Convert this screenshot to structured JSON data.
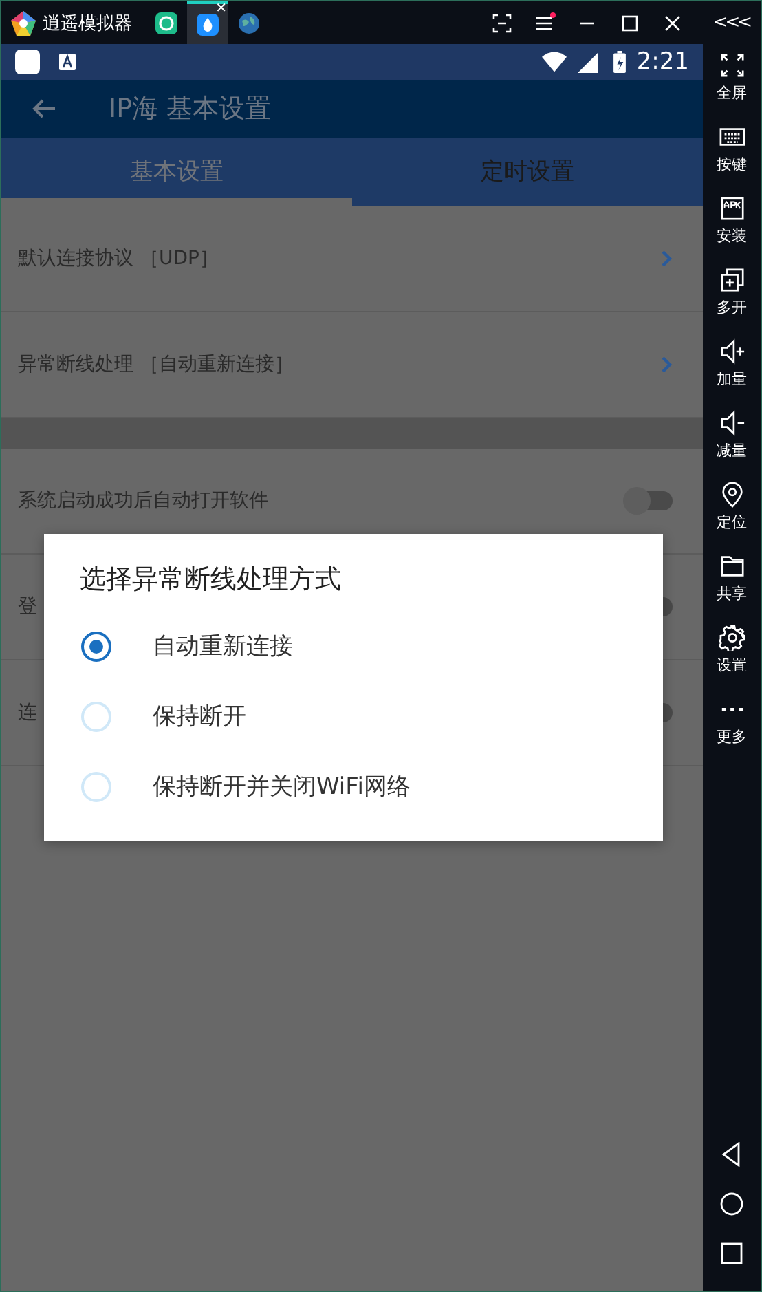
{
  "emulator": {
    "title": "逍遥模拟器",
    "app_tabs": [
      {
        "kind": "green",
        "selected": false
      },
      {
        "kind": "drop",
        "selected": true,
        "close": "✕"
      },
      {
        "kind": "globe",
        "selected": false
      }
    ],
    "collapse": "<<<"
  },
  "status_bar": {
    "time": "2:21"
  },
  "app_bar": {
    "title": "IP海 基本设置"
  },
  "tabs": [
    {
      "label": "基本设置",
      "selected": true
    },
    {
      "label": "定时设置",
      "selected": false
    }
  ],
  "settings": [
    {
      "kind": "link",
      "label": "默认连接协议 ［UDP］"
    },
    {
      "kind": "link",
      "label": "异常断线处理 ［自动重新连接］"
    },
    {
      "kind": "gap"
    },
    {
      "kind": "toggle",
      "label": "系统启动成功后自动打开软件",
      "on": false
    },
    {
      "kind": "toggle",
      "label": "登",
      "on": false
    },
    {
      "kind": "toggle",
      "label": "连",
      "on": false
    }
  ],
  "dialog": {
    "title": "选择异常断线处理方式",
    "options": [
      {
        "label": "自动重新连接",
        "selected": true
      },
      {
        "label": "保持断开",
        "selected": false
      },
      {
        "label": "保持断开并关闭WiFi网络",
        "selected": false
      }
    ]
  },
  "sidebar": [
    {
      "kind": "fullscreen",
      "label": "全屏"
    },
    {
      "kind": "keyboard",
      "label": "按键"
    },
    {
      "kind": "apk",
      "label": "安装"
    },
    {
      "kind": "multi",
      "label": "多开"
    },
    {
      "kind": "volup",
      "label": "加量"
    },
    {
      "kind": "voldown",
      "label": "减量"
    },
    {
      "kind": "pin",
      "label": "定位"
    },
    {
      "kind": "folder",
      "label": "共享"
    },
    {
      "kind": "gear",
      "label": "设置"
    },
    {
      "kind": "more",
      "label": "更多"
    }
  ]
}
